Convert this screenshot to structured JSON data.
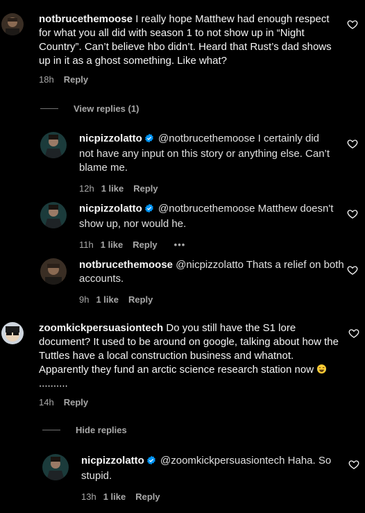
{
  "comments": [
    {
      "username": "notbrucethemoose",
      "text": "I really hope Matthew had enough respect for what you all did with season 1 to not show up in “Night Country”. Can’t believe hbo didn’t. Heard that Rust’s dad shows up in it as a ghost something. Like what?",
      "time": "18h",
      "reply_label": "Reply",
      "toggle_label": "View replies (1)",
      "replies": [
        {
          "username": "nicpizzolatto",
          "verified": true,
          "text": "@notbrucethemoose I certainly did not have any input on this story or anything else. Can’t blame me.",
          "time": "12h",
          "likes": "1 like",
          "reply_label": "Reply"
        },
        {
          "username": "nicpizzolatto",
          "verified": true,
          "text": "@notbrucethemoose Matthew doesn't show up, nor would he.",
          "time": "11h",
          "likes": "1 like",
          "reply_label": "Reply",
          "more": "•••"
        },
        {
          "username": "notbrucethemoose",
          "verified": false,
          "text": "@nicpizzolatto Thats a relief on both accounts.",
          "time": "9h",
          "likes": "1 like",
          "reply_label": "Reply"
        }
      ]
    },
    {
      "username": "zoomkickpersuasiontech",
      "text": "Do you still have the S1 lore document? It used to be around on google, talking about how the Tuttles have a local construction business and whatnot. Apparently they fund an arctic science research station now",
      "text_tail": "..........",
      "emoji": "tears-of-joy-emoji",
      "time": "14h",
      "reply_label": "Reply",
      "toggle_label": "Hide replies",
      "replies": [
        {
          "username": "nicpizzolatto",
          "verified": true,
          "text": "@zoomkickpersuasiontech Haha. So stupid.",
          "time": "13h",
          "likes": "1 like",
          "reply_label": "Reply"
        }
      ]
    }
  ],
  "colors": {
    "background": "#000000",
    "text": "#f5f5f5",
    "muted": "#a8a8a8",
    "verified": "#0095f6"
  },
  "icons": {
    "like": "heart-outline-icon",
    "verified": "verified-badge-icon",
    "more": "more-dots-icon"
  }
}
